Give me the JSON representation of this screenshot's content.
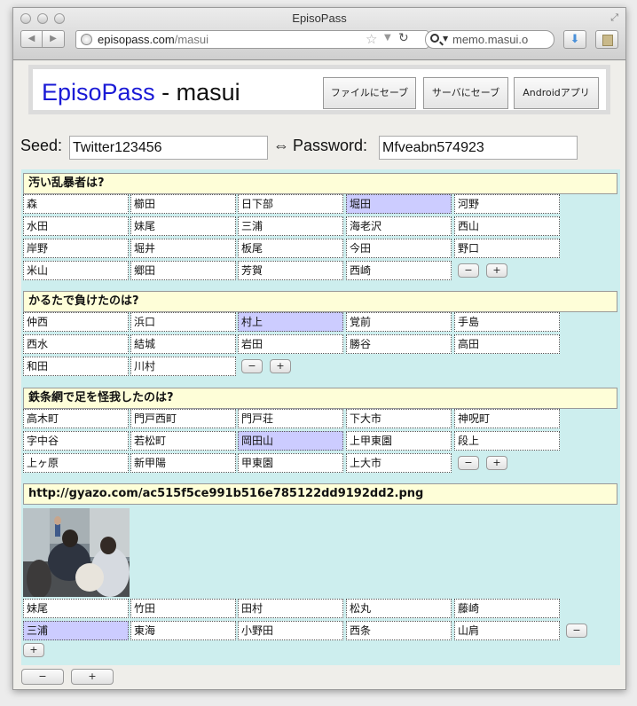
{
  "window": {
    "title": "EpisoPass"
  },
  "browser": {
    "url_host": "episopass.com",
    "url_path": "/masui",
    "search_text": "memo.masui.o"
  },
  "header": {
    "logo_brand": "EpisoPass",
    "logo_sep": " - ",
    "logo_user": "masui",
    "save_file_label": "ファイルにセーブ",
    "save_server_label": "サーバにセーブ",
    "android_label": "Androidアプリ"
  },
  "seed": {
    "seed_label": "Seed:",
    "seed_value": "Twitter123456",
    "arrow": "⇔",
    "password_label": "Password:",
    "password_value": "Mfveabn574923"
  },
  "controls": {
    "minus": "−",
    "plus": "+"
  },
  "questions": [
    {
      "title": "汚い乱暴者は?",
      "answers": [
        "森",
        "櫛田",
        "日下部",
        "堀田",
        "河野",
        "水田",
        "妹尾",
        "三浦",
        "海老沢",
        "西山",
        "岸野",
        "堀井",
        "板尾",
        "今田",
        "野口",
        "米山",
        "郷田",
        "芳賀",
        "西崎"
      ],
      "selected": "堀田"
    },
    {
      "title": "かるたで負けたのは?",
      "answers": [
        "仲西",
        "浜口",
        "村上",
        "覚前",
        "手島",
        "西水",
        "結城",
        "岩田",
        "勝谷",
        "高田",
        "和田",
        "川村"
      ],
      "selected": "村上"
    },
    {
      "title": "鉄条網で足を怪我したのは?",
      "answers": [
        "高木町",
        "門戸西町",
        "門戸荘",
        "下大市",
        "神呪町",
        "字中谷",
        "若松町",
        "岡田山",
        "上甲東園",
        "段上",
        "上ヶ原",
        "新甲陽",
        "甲東園",
        "上大市"
      ],
      "selected": "岡田山"
    },
    {
      "title": "http://gyazo.com/ac515f5ce991b516e785122dd9192dd2.png",
      "answers": [
        "妹尾",
        "竹田",
        "田村",
        "松丸",
        "藤崎",
        "三浦",
        "東海",
        "小野田",
        "西条",
        "山肩"
      ],
      "selected": "三浦"
    }
  ]
}
